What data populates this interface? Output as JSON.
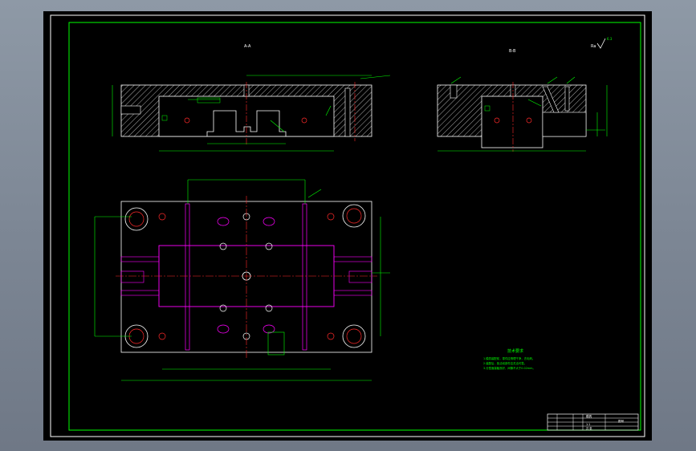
{
  "drawing": {
    "section_a_label": "A-A",
    "section_b_label": "B-B",
    "roughness_symbol": "Ra",
    "roughness_value": "6.3",
    "tech_requirements_title": "技术要求",
    "tech_requirements": [
      "1.模具装配前，零件应清理干净，去毛刺。",
      "2.装配后，各活动部件应灵活可靠。",
      "3.分型面接触良好，间隙不大于0.02mm。"
    ],
    "title_block": {
      "drawing_name": "模具",
      "scale": "1:1",
      "sheet": "共 张",
      "code": "图号"
    }
  },
  "colors": {
    "frame": "#00ff00",
    "outline": "#ffffff",
    "center": "#ff2a2a",
    "part": "#ff00ff",
    "hatch": "#ffffff"
  }
}
